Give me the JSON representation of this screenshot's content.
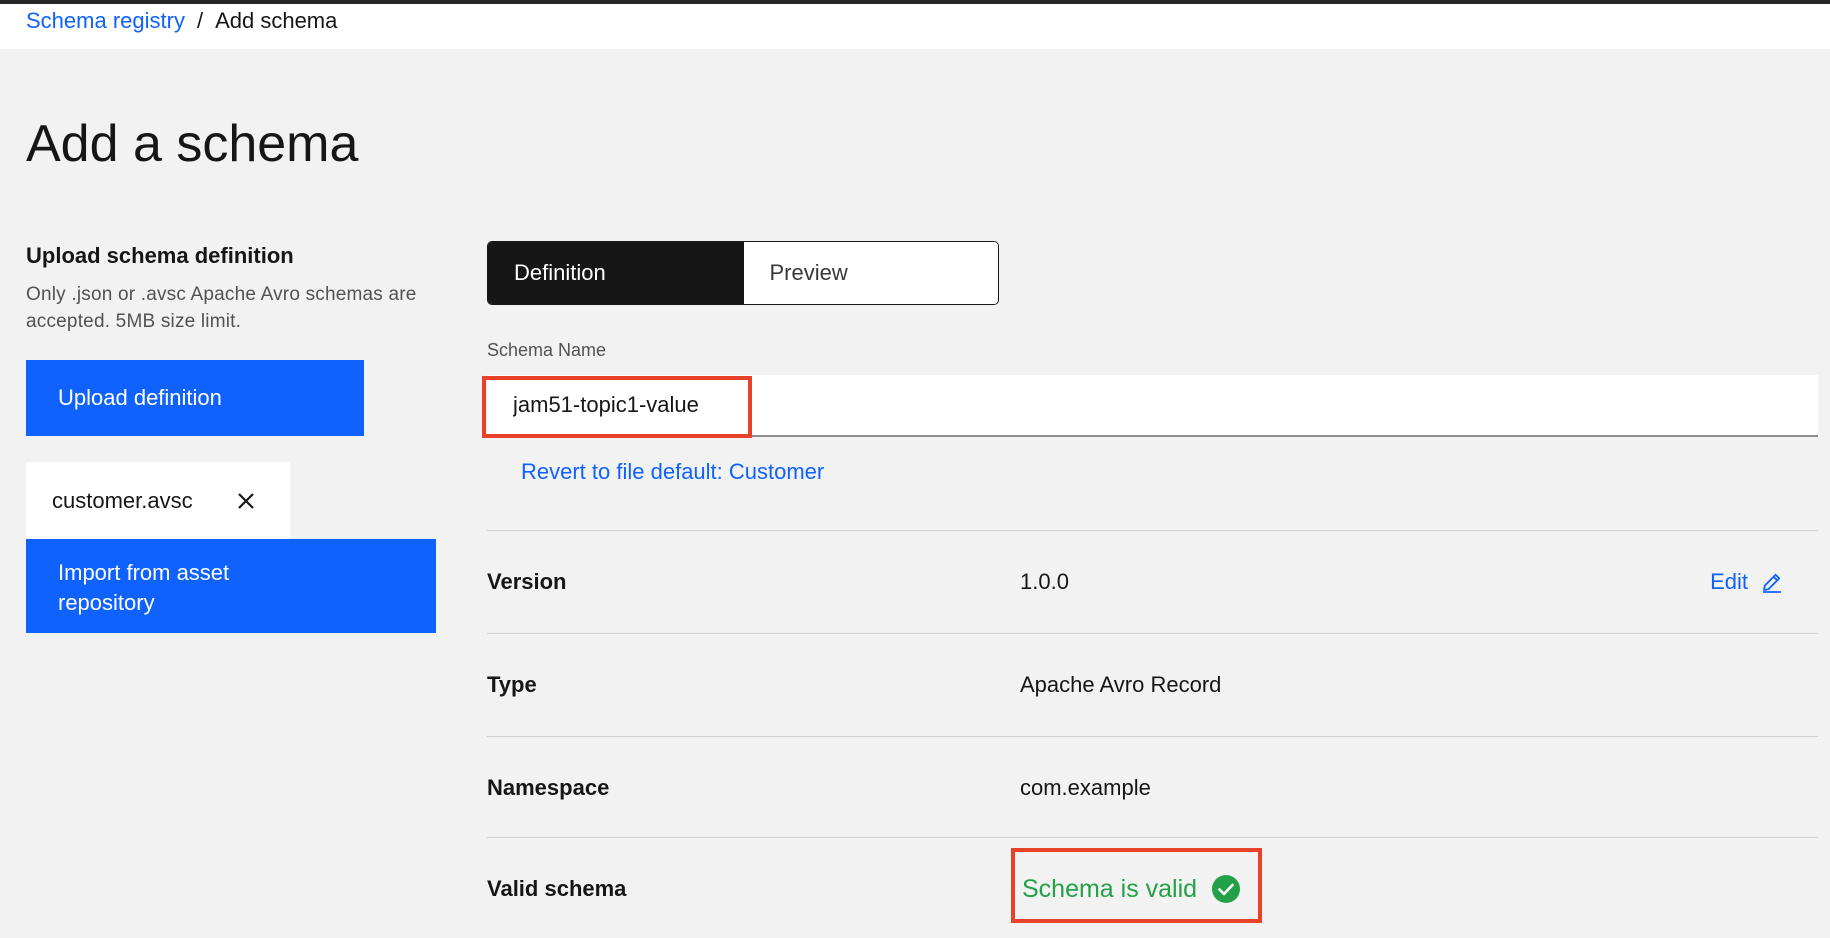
{
  "breadcrumb": {
    "parent": "Schema registry",
    "separator": "/",
    "current": "Add schema"
  },
  "page": {
    "title": "Add a schema"
  },
  "upload": {
    "heading": "Upload schema definition",
    "description": "Only .json or .avsc Apache Avro schemas are accepted. 5MB size limit.",
    "upload_button": "Upload definition",
    "file_name": "customer.avsc",
    "import_button": "Import from asset repository"
  },
  "tabs": [
    {
      "label": "Definition",
      "active": true
    },
    {
      "label": "Preview",
      "active": false
    }
  ],
  "schema_name": {
    "label": "Schema Name",
    "value": "jam51-topic1-value",
    "revert_link": "Revert to file default: Customer"
  },
  "details": {
    "version": {
      "label": "Version",
      "value": "1.0.0",
      "edit": "Edit"
    },
    "type": {
      "label": "Type",
      "value": "Apache Avro Record"
    },
    "namespace": {
      "label": "Namespace",
      "value": "com.example"
    },
    "valid": {
      "label": "Valid schema",
      "value": "Schema is valid"
    }
  },
  "colors": {
    "primary": "#0f62fe",
    "success": "#24a148",
    "highlight": "#e8422a",
    "background": "#f2f2f2"
  },
  "icons": {
    "file_remove": "close-icon",
    "edit": "pencil-icon",
    "valid": "checkmark-filled-icon"
  }
}
